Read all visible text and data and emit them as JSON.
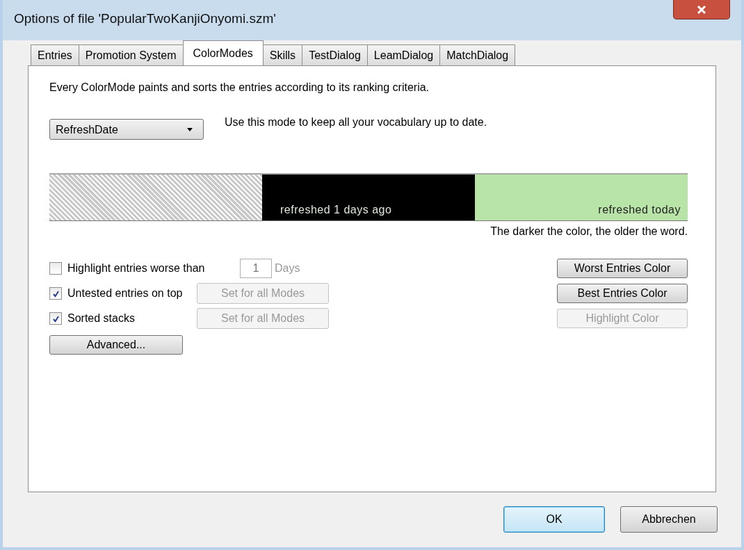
{
  "window": {
    "title": "Options of file 'PopularTwoKanjiOnyomi.szm'"
  },
  "tabs": [
    {
      "label": "Entries",
      "selected": false
    },
    {
      "label": "Promotion System",
      "selected": false
    },
    {
      "label": "ColorModes",
      "selected": true
    },
    {
      "label": "Skills",
      "selected": false
    },
    {
      "label": "TestDialog",
      "selected": false
    },
    {
      "label": "LeamDialog",
      "selected": false
    },
    {
      "label": "MatchDialog",
      "selected": false
    }
  ],
  "intro": "Every ColorMode paints and sorts the entries according to its ranking criteria.",
  "mode_select": {
    "value": "RefreshDate"
  },
  "mode_description": "Use this mode to keep all your vocabulary up to date.",
  "color_bar": [
    {
      "kind": "hatched",
      "color": "#c8c8c8"
    },
    {
      "kind": "solid",
      "color": "#000000",
      "label": "refreshed 1 days ago"
    },
    {
      "kind": "solid",
      "color": "#b9e4a8",
      "label": "refreshed today"
    }
  ],
  "legend": "The darker the color, the older the word.",
  "highlight": {
    "label": "Highlight entries worse than",
    "checked": false,
    "value": "1",
    "unit": "Days"
  },
  "options": [
    {
      "label": "Untested entries on top",
      "checked": true,
      "button": {
        "label": "Set for all Modes",
        "disabled": true
      }
    },
    {
      "label": "Sorted stacks",
      "checked": true,
      "button": {
        "label": "Set for all Modes",
        "disabled": true
      }
    }
  ],
  "advanced_button": "Advanced...",
  "color_buttons": [
    {
      "label": "Worst Entries Color",
      "disabled": false
    },
    {
      "label": "Best Entries Color",
      "disabled": false
    },
    {
      "label": "Highlight Color",
      "disabled": true
    }
  ],
  "dialog_buttons": [
    {
      "label": "OK",
      "default": true
    },
    {
      "label": "Abbrechen",
      "default": false
    }
  ]
}
